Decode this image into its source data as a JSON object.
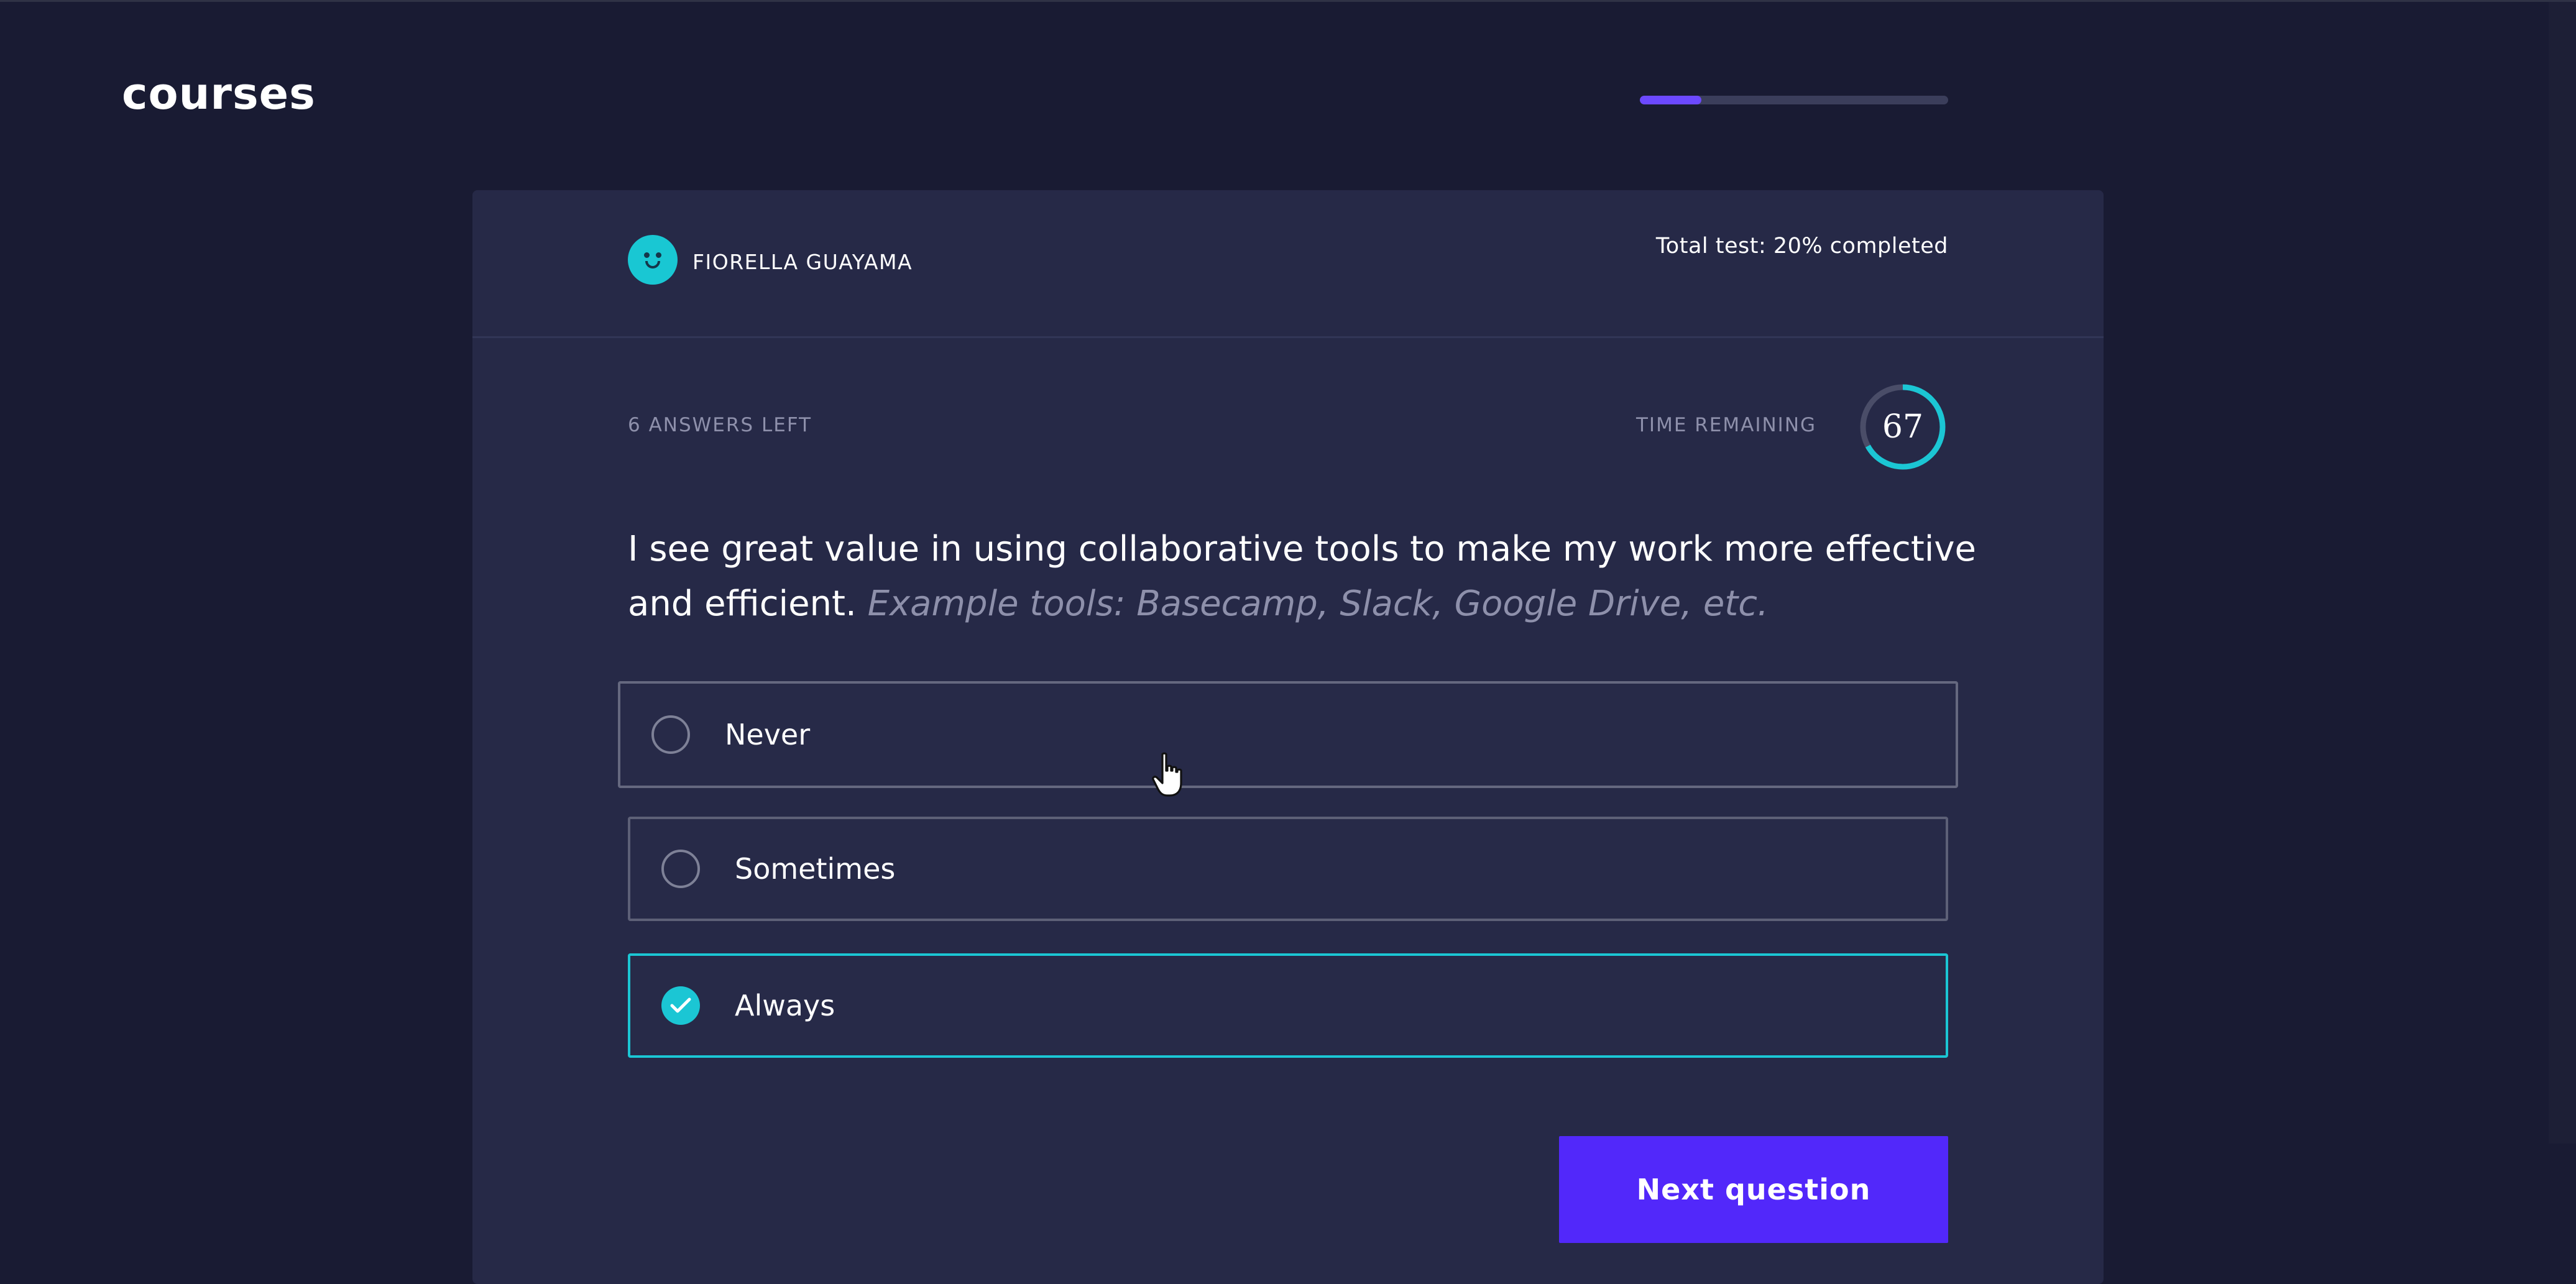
{
  "app": {
    "logo": "courses"
  },
  "header": {
    "user_name": "FIORELLA GUAYAMA",
    "progress_label": "Total test: 20% completed",
    "progress_fraction": 0.2
  },
  "quiz": {
    "answers_left": "6 ANSWERS LEFT",
    "time_label": "TIME REMAINING",
    "timer_value": "67",
    "timer_fraction": 0.67,
    "question_main": "I see great value in using collaborative tools to make my work more effective and efficient.",
    "question_example": "Example tools: Basecamp, Slack, Google Drive, etc.",
    "options": [
      {
        "label": "Never",
        "selected": false
      },
      {
        "label": "Sometimes",
        "selected": false
      },
      {
        "label": "Always",
        "selected": true
      }
    ],
    "next_label": "Next question"
  },
  "colors": {
    "background": "#191b33",
    "card": "#262947",
    "accent_teal": "#1bc6d4",
    "accent_purple": "#5228fa",
    "progress_fill": "#6c49ff"
  },
  "icons": {
    "avatar": "smiley-avatar-icon",
    "check": "check-icon",
    "cursor": "hand-pointer-icon"
  }
}
